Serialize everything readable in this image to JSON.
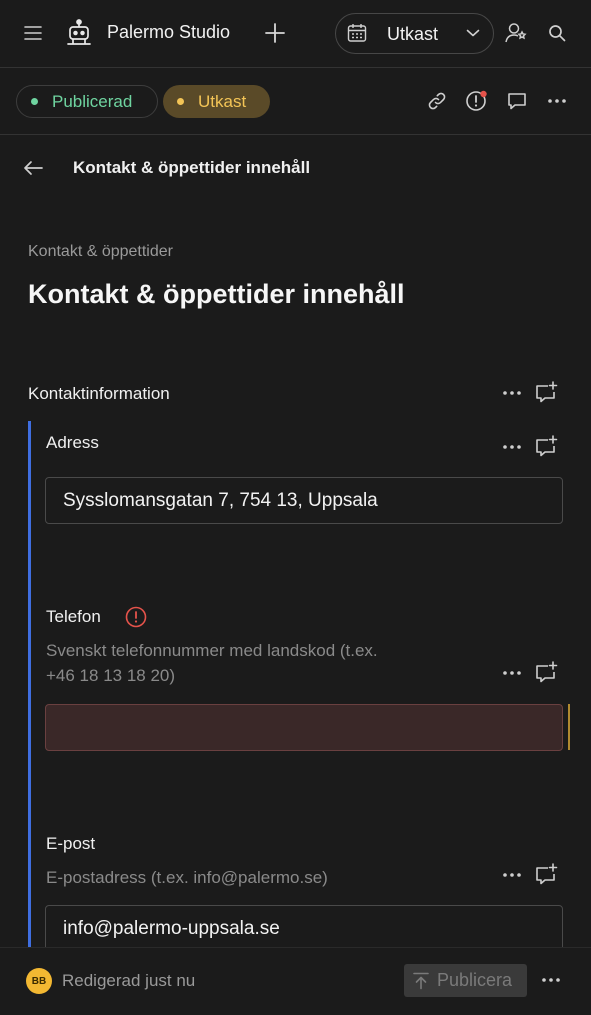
{
  "topbar": {
    "app_name": "Palermo Studio",
    "version_label": "Utkast"
  },
  "status": {
    "published_label": "Publicerad",
    "draft_label": "Utkast",
    "published_color": "#6fd4a0",
    "draft_color": "#f3c456"
  },
  "page": {
    "back_title": "Kontakt & öppettider innehåll",
    "breadcrumb": "Kontakt & öppettider",
    "title": "Kontakt & öppettider innehåll"
  },
  "section": {
    "title": "Kontaktinformation",
    "accent_color": "#3f6ee0"
  },
  "fields": {
    "address": {
      "label": "Adress",
      "value": "Sysslomansgatan 7, 754 13, Uppsala"
    },
    "phone": {
      "label": "Telefon",
      "description_line1": "Svenskt telefonnummer med landskod (t.ex.",
      "description_line2": "+46 18 13 18 20)",
      "value": "",
      "error_color": "#e5534b"
    },
    "email": {
      "label": "E-post",
      "description": "E-postadress (t.ex. info@palermo.se)",
      "value": "info@palermo-uppsala.se"
    }
  },
  "footer": {
    "avatar_initials": "BB",
    "edited_text": "Redigerad just nu",
    "publish_label": "Publicera"
  },
  "icons": [
    "menu-icon",
    "robot-logo-icon",
    "plus-icon",
    "calendar-icon",
    "chevron-down-icon",
    "user-settings-icon",
    "search-icon",
    "link-icon",
    "alert-icon",
    "comment-icon",
    "more-icon",
    "back-arrow-icon",
    "add-comment-icon",
    "error-icon",
    "upload-icon"
  ]
}
